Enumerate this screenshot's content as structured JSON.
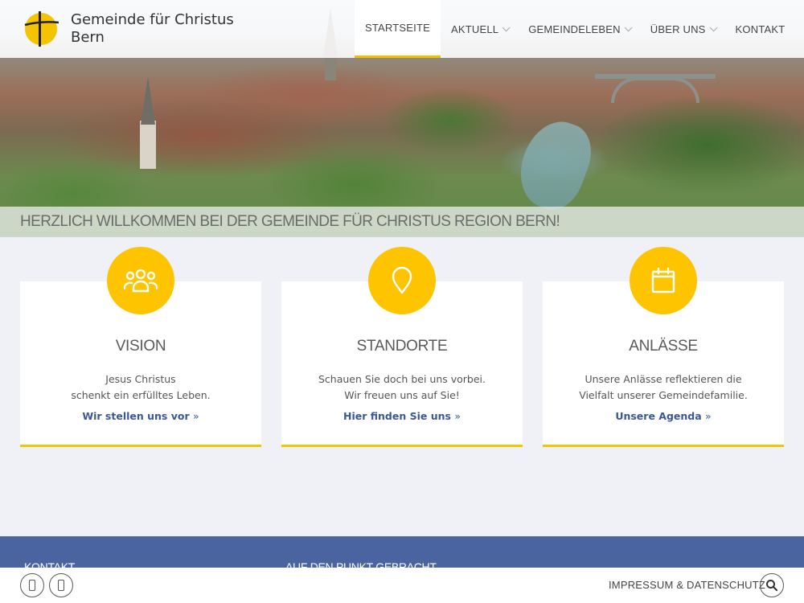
{
  "site": {
    "title_line1": "Gemeinde für Christus",
    "title_line2": "Bern"
  },
  "nav": {
    "items": [
      {
        "label": "STARTSEITE",
        "active": true,
        "dropdown": false
      },
      {
        "label": "AKTUELL",
        "active": false,
        "dropdown": true
      },
      {
        "label": "GEMEINDELEBEN",
        "active": false,
        "dropdown": true
      },
      {
        "label": "ÜBER UNS",
        "active": false,
        "dropdown": true
      },
      {
        "label": "KONTAKT",
        "active": false,
        "dropdown": false
      }
    ]
  },
  "hero": {
    "welcome": "HERZLICH WILLKOMMEN BEI DER GEMEINDE FÜR CHRISTUS REGION BERN!"
  },
  "cards": [
    {
      "icon": "people-icon",
      "title": "VISION",
      "line1": "Jesus Christus",
      "line2": "schenkt ein erfülltes Leben.",
      "link": "Wir stellen uns vor"
    },
    {
      "icon": "location-pin-icon",
      "title": "STANDORTE",
      "line1": "Schauen Sie doch bei uns vorbei.",
      "line2": "Wir freuen uns auf Sie!",
      "link": "Hier finden Sie uns"
    },
    {
      "icon": "calendar-icon",
      "title": "ANLÄSSE",
      "line1": "Unsere Anlässe reflektieren die",
      "line2": "Vielfalt unserer Gemeindefamilie.",
      "link": "Unsere Agenda"
    }
  ],
  "footer": {
    "col1_title": "KONTAKT",
    "col2_title": "AUF DEN PUNKT GEBRACHT",
    "impressum": "IMPRESSUM & DATENSCHUTZ"
  },
  "colors": {
    "accent": "#ffc400",
    "link": "#3a5796",
    "footer": "#4a64a0",
    "background": "#eff1f6"
  }
}
